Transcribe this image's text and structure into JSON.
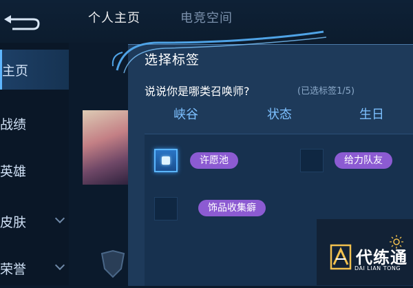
{
  "header": {
    "tabs": [
      {
        "label": "个人主页"
      },
      {
        "label": "电竞空间"
      }
    ]
  },
  "sidebar": {
    "items": [
      {
        "label": "主页"
      },
      {
        "label": "战绩"
      },
      {
        "label": "英雄"
      },
      {
        "label": "皮肤"
      },
      {
        "label": "荣誉"
      }
    ]
  },
  "dialog": {
    "title": "选择标签",
    "question": "说说你是哪类召唤师?",
    "selected_count": "(已选标签1/5)",
    "categories": [
      {
        "label": "峡谷"
      },
      {
        "label": "状态"
      },
      {
        "label": "生日"
      }
    ],
    "tags": [
      {
        "label": "许愿池",
        "checked": true
      },
      {
        "label": "给力队友",
        "checked": false
      },
      {
        "label": "饰品收集癖",
        "checked": false
      }
    ]
  },
  "watermark": {
    "text": "代练通",
    "sub": "DAI LIAN TONG"
  },
  "colors": {
    "background": "#0b1a2c",
    "dialog": "#1e3a5a",
    "accent": "#7dc0ff",
    "tag_purple": "#8c5bd2",
    "checkbox_active": "#5bb6ff"
  }
}
